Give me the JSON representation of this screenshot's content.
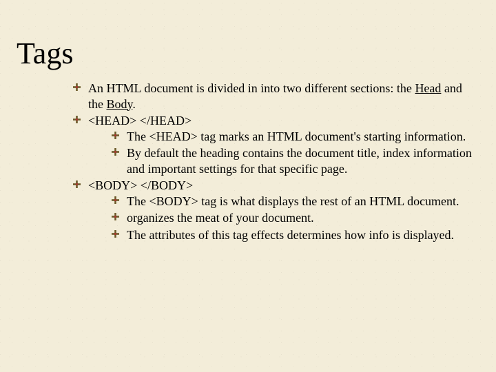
{
  "title": "Tags",
  "b1": {
    "text_a": "An HTML document is divided in into two different sections: the ",
    "head": "Head",
    "text_b": " and the ",
    "body": "Body",
    "text_c": "."
  },
  "b2": {
    "text": "<HEAD>    </HEAD>",
    "sub1": "The <HEAD> tag marks an HTML document's starting information.",
    "sub2": "By default the heading contains the document title, index information and important settings for that specific page."
  },
  "b3": {
    "text": "<BODY>   </BODY>",
    "sub1": "The <BODY> tag is what displays the rest of an HTML document.",
    "sub2": "organizes the meat of your document.",
    "sub3": "The attributes of this tag effects determines how info is displayed."
  }
}
